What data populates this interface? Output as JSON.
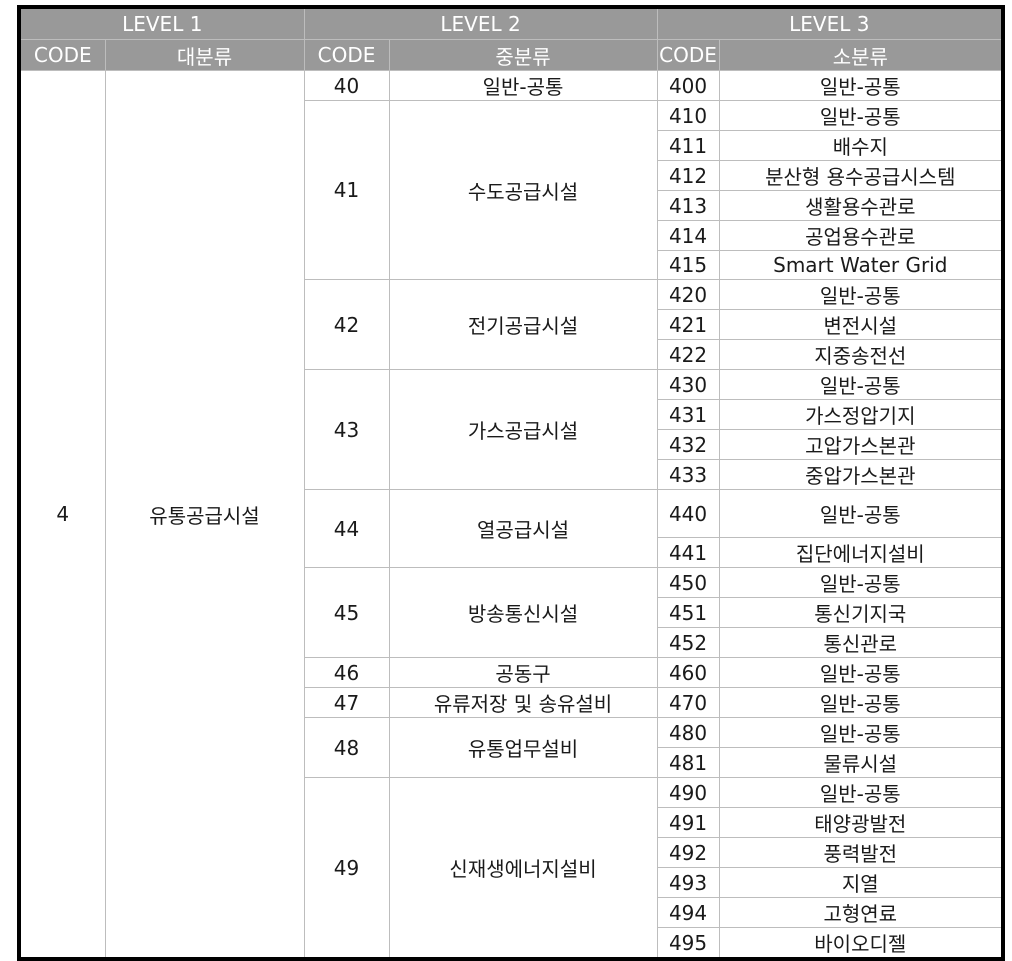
{
  "header": {
    "level1": "LEVEL  1",
    "level2": "LEVEL  2",
    "level3": "LEVEL 3",
    "code1": "CODE",
    "name1": "대분류",
    "code2": "CODE",
    "name2": "중분류",
    "code3": "CODE",
    "name3": "소분류"
  },
  "level1": {
    "code": "4",
    "name": "유통공급시설"
  },
  "groups": [
    {
      "code": "40",
      "name": "일반-공통",
      "items": [
        {
          "code": "400",
          "name": "일반-공통"
        }
      ]
    },
    {
      "code": "41",
      "name": "수도공급시설",
      "items": [
        {
          "code": "410",
          "name": "일반-공통"
        },
        {
          "code": "411",
          "name": "배수지"
        },
        {
          "code": "412",
          "name": "분산형 용수공급시스템"
        },
        {
          "code": "413",
          "name": "생활용수관로"
        },
        {
          "code": "414",
          "name": "공업용수관로"
        },
        {
          "code": "415",
          "name": "Smart Water Grid"
        }
      ]
    },
    {
      "code": "42",
      "name": "전기공급시설",
      "items": [
        {
          "code": "420",
          "name": "일반-공통"
        },
        {
          "code": "421",
          "name": "변전시설"
        },
        {
          "code": "422",
          "name": "지중송전선"
        }
      ]
    },
    {
      "code": "43",
      "name": "가스공급시설",
      "items": [
        {
          "code": "430",
          "name": "일반-공통"
        },
        {
          "code": "431",
          "name": "가스정압기지"
        },
        {
          "code": "432",
          "name": "고압가스본관"
        },
        {
          "code": "433",
          "name": "중압가스본관"
        }
      ]
    },
    {
      "code": "44",
      "name": "열공급시설",
      "items": [
        {
          "code": "440",
          "name": "일반-공통"
        },
        {
          "code": "441",
          "name": "집단에너지설비"
        }
      ]
    },
    {
      "code": "45",
      "name": "방송통신시설",
      "items": [
        {
          "code": "450",
          "name": "일반-공통"
        },
        {
          "code": "451",
          "name": "통신기지국"
        },
        {
          "code": "452",
          "name": "통신관로"
        }
      ]
    },
    {
      "code": "46",
      "name": "공동구",
      "items": [
        {
          "code": "460",
          "name": "일반-공통"
        }
      ]
    },
    {
      "code": "47",
      "name": "유류저장 및 송유설비",
      "items": [
        {
          "code": "470",
          "name": "일반-공통"
        }
      ]
    },
    {
      "code": "48",
      "name": "유통업무설비",
      "items": [
        {
          "code": "480",
          "name": "일반-공통"
        },
        {
          "code": "481",
          "name": "물류시설"
        }
      ]
    },
    {
      "code": "49",
      "name": "신재생에너지설비",
      "items": [
        {
          "code": "490",
          "name": "일반-공통"
        },
        {
          "code": "491",
          "name": "태양광발전"
        },
        {
          "code": "492",
          "name": "풍력발전"
        },
        {
          "code": "493",
          "name": "지열"
        },
        {
          "code": "494",
          "name": "고형연료"
        },
        {
          "code": "495",
          "name": "바이오디젤"
        }
      ]
    }
  ]
}
